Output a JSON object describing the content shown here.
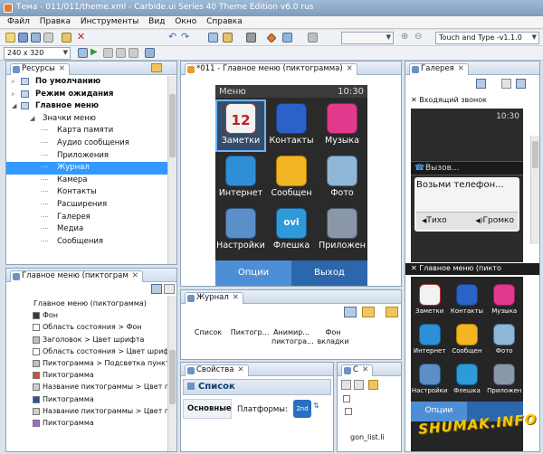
{
  "window": {
    "title": "Тема - 011/011/theme.xml - Carbide.ui Series 40 Theme Edition v6.0 rus"
  },
  "menu": [
    "Файл",
    "Правка",
    "Инструменты",
    "Вид",
    "Окно",
    "Справка"
  ],
  "toolbar": {
    "resolution": "240 x 320",
    "profile": "Touch and Type -v1.1.0"
  },
  "resources": {
    "tab": "Ресурсы",
    "items": [
      {
        "label": "По умолчанию",
        "bold": true,
        "depth": 1
      },
      {
        "label": "Режим ожидания",
        "bold": true,
        "depth": 1
      },
      {
        "label": "Главное меню",
        "bold": true,
        "depth": 1
      },
      {
        "label": "Значки меню",
        "bold": false,
        "depth": 2
      },
      {
        "label": "Карта памяти",
        "bold": false,
        "depth": 3
      },
      {
        "label": "Аудио сообщения",
        "bold": false,
        "depth": 3
      },
      {
        "label": "Приложения",
        "bold": false,
        "depth": 3
      },
      {
        "label": "Журнал",
        "bold": false,
        "depth": 3,
        "selected": true
      },
      {
        "label": "Камера",
        "bold": false,
        "depth": 3
      },
      {
        "label": "Контакты",
        "bold": false,
        "depth": 3
      },
      {
        "label": "Расширения",
        "bold": false,
        "depth": 3
      },
      {
        "label": "Галерея",
        "bold": false,
        "depth": 3
      },
      {
        "label": "Медиа",
        "bold": false,
        "depth": 3
      },
      {
        "label": "Сообщения",
        "bold": false,
        "depth": 3
      }
    ]
  },
  "inspector": {
    "tab": "Главное меню (пиктограм",
    "items": [
      "Главное меню (пиктограмма)",
      "Фон",
      "Область состояния > Фон",
      "Заголовок > Цвет шрифта",
      "Область состояния > Цвет шрифта",
      "Пиктограмма > Подсветка пункта",
      "Пиктограмма",
      "Название пиктограммы > Цвет по",
      "Пиктограмма",
      "Название пиктограммы > Цвет по",
      "Пиктограмма"
    ]
  },
  "editor": {
    "tab": "*011 - Главное меню (пиктограмма)",
    "screen": {
      "header": "Меню",
      "time": "10:30",
      "icons": [
        "Заметки",
        "Контакты",
        "Музыка",
        "Интернет",
        "Сообщен",
        "Фото",
        "Настройки",
        "Флешка",
        "Приложен"
      ],
      "ovi": "ovi",
      "calendar_day": "12",
      "soft_left": "Опции",
      "soft_right": "Выход"
    }
  },
  "journal": {
    "tab": "Журнал",
    "items": [
      "Список",
      "Пиктогр...",
      "Анимир... пиктогра...",
      "Фон вкладки"
    ]
  },
  "properties": {
    "tab": "Свойства",
    "header": "Список",
    "col1": "Основные",
    "col2": "Платформы:",
    "badge": "2nd"
  },
  "smallpanel": {
    "tab": "С",
    "item": "gon_list.li"
  },
  "gallery": {
    "tab": "Галерея",
    "incoming": {
      "title": "Входящий звонок",
      "time": "10:30",
      "call": "Вызов...",
      "prompt": "Возьми телефон...",
      "mute": "Тихо",
      "loud": "Громко"
    },
    "mainmenu": {
      "title": "Главное меню (пикто",
      "icons": [
        "Заметки",
        "Контакты",
        "Музыка",
        "Интернет",
        "Сообщен",
        "Фото",
        "Настройки",
        "Флешка",
        "Приложен"
      ],
      "soft_left": "Опции"
    }
  },
  "watermark": "SHUMAK.INFO",
  "colors": {
    "selection": "#3399ff",
    "softbar": "#3a7bc8",
    "phone_bg": "#1b1b1b"
  }
}
